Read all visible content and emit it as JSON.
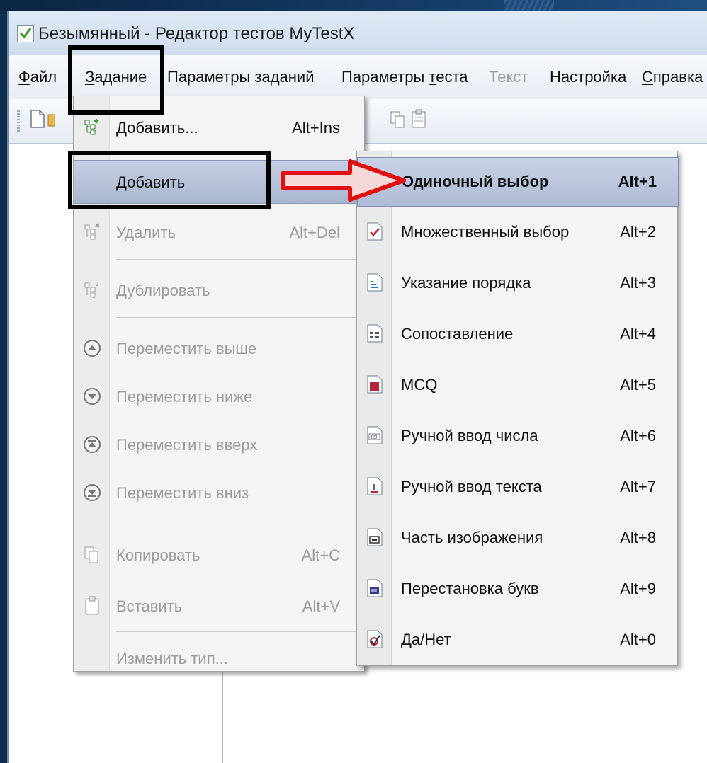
{
  "window": {
    "title": "Безымянный - Редактор тестов MyTestX"
  },
  "menubar": [
    {
      "label_pre": "",
      "label_mnem": "Ф",
      "label_post": "айл",
      "disabled": false
    },
    {
      "label_pre": "",
      "label_mnem": "З",
      "label_post": "адание",
      "disabled": false
    },
    {
      "label_pre": "Параметры заданий",
      "label_mnem": "",
      "label_post": "",
      "disabled": false
    },
    {
      "label_pre": "Параметры ",
      "label_mnem": "т",
      "label_post": "еста",
      "disabled": false
    },
    {
      "label_pre": "Текст",
      "label_mnem": "",
      "label_post": "",
      "disabled": true
    },
    {
      "label_pre": "Настройка",
      "label_mnem": "",
      "label_post": "",
      "disabled": false
    },
    {
      "label_pre": "",
      "label_mnem": "С",
      "label_post": "правка",
      "disabled": false
    }
  ],
  "task_menu": {
    "items": [
      {
        "label": "Добавить...",
        "shortcut": "Alt+Ins",
        "icon": "add-task-icon",
        "disabled": false
      },
      {
        "label": "Добавить",
        "shortcut": "",
        "icon": "",
        "disabled": false,
        "highlight": true,
        "submenu": true
      },
      {
        "label": "Удалить",
        "shortcut": "Alt+Del",
        "icon": "delete-task-icon",
        "disabled": true
      },
      {
        "label": "Дублировать",
        "shortcut": "",
        "icon": "duplicate-task-icon",
        "disabled": true
      },
      {
        "label": "Переместить выше",
        "shortcut": "",
        "icon": "move-up-icon",
        "disabled": true
      },
      {
        "label": "Переместить ниже",
        "shortcut": "",
        "icon": "move-down-icon",
        "disabled": true
      },
      {
        "label": "Переместить вверх",
        "shortcut": "",
        "icon": "move-top-icon",
        "disabled": true
      },
      {
        "label": "Переместить вниз",
        "shortcut": "",
        "icon": "move-bottom-icon",
        "disabled": true
      },
      {
        "label": "Копировать",
        "shortcut": "Alt+C",
        "icon": "copy-icon",
        "disabled": true
      },
      {
        "label": "Вставить",
        "shortcut": "Alt+V",
        "icon": "paste-icon",
        "disabled": true
      },
      {
        "label": "Изменить тип...",
        "shortcut": "",
        "icon": "",
        "disabled": true
      }
    ]
  },
  "sub_menu": {
    "items": [
      {
        "label": "Одиночный выбор",
        "shortcut": "Alt+1",
        "icon": "single-choice-icon",
        "highlight": true
      },
      {
        "label": "Множественный выбор",
        "shortcut": "Alt+2",
        "icon": "multiple-choice-icon"
      },
      {
        "label": "Указание порядка",
        "shortcut": "Alt+3",
        "icon": "ordering-icon"
      },
      {
        "label": "Сопоставление",
        "shortcut": "Alt+4",
        "icon": "matching-icon"
      },
      {
        "label": "MCQ",
        "shortcut": "Alt+5",
        "icon": "mcq-icon"
      },
      {
        "label": "Ручной ввод числа",
        "shortcut": "Alt+6",
        "icon": "number-input-icon"
      },
      {
        "label": "Ручной ввод текста",
        "shortcut": "Alt+7",
        "icon": "text-input-icon"
      },
      {
        "label": "Часть изображения",
        "shortcut": "Alt+8",
        "icon": "image-part-icon"
      },
      {
        "label": "Перестановка букв",
        "shortcut": "Alt+9",
        "icon": "letter-shuffle-icon"
      },
      {
        "label": "Да/Нет",
        "shortcut": "Alt+0",
        "icon": "yes-no-icon"
      }
    ]
  },
  "colors": {
    "annotation": "#000000",
    "arrow": "#e01010",
    "highlight": "#b4c0d9"
  }
}
